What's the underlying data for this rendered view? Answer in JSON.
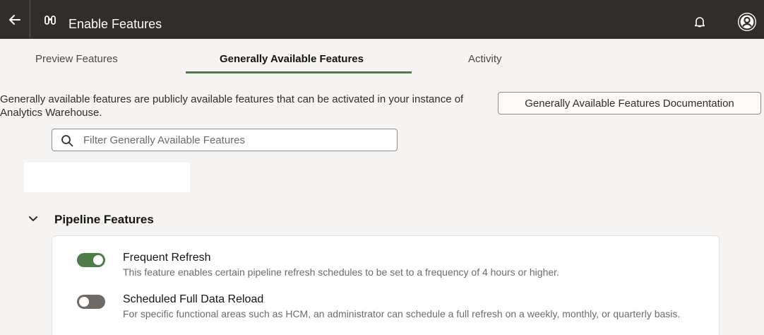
{
  "header": {
    "title": "Enable Features",
    "back_icon": "arrow-left-icon",
    "app_icon": "binoculars-icon",
    "notifications_icon": "bell-icon",
    "user_icon": "user-avatar-icon"
  },
  "tabs": [
    {
      "label": "Preview Features",
      "selected": false
    },
    {
      "label": "Generally Available Features",
      "selected": true
    },
    {
      "label": "Activity",
      "selected": false
    }
  ],
  "content": {
    "description": "Generally available features are publicly available features that can be activated in your instance of Analytics Warehouse.",
    "documentation_button": "Generally Available Features Documentation",
    "filter_placeholder": "Filter Generally Available Features"
  },
  "section": {
    "title": "Pipeline Features",
    "expanded": true,
    "features": [
      {
        "title": "Frequent Refresh",
        "description": "This feature enables certain pipeline refresh schedules to be set to a frequency of 4 hours or higher.",
        "enabled": true
      },
      {
        "title": "Scheduled Full Data Reload",
        "description": "For specific functional areas such as HCM, an administrator can schedule a full refresh on a weekly, monthly, or quarterly basis.",
        "enabled": false
      }
    ]
  },
  "colors": {
    "header_bg": "#312d2a",
    "accent_green": "#4d7d47",
    "toggle_off": "#6f6a66",
    "page_bg": "#f5f4f2"
  }
}
